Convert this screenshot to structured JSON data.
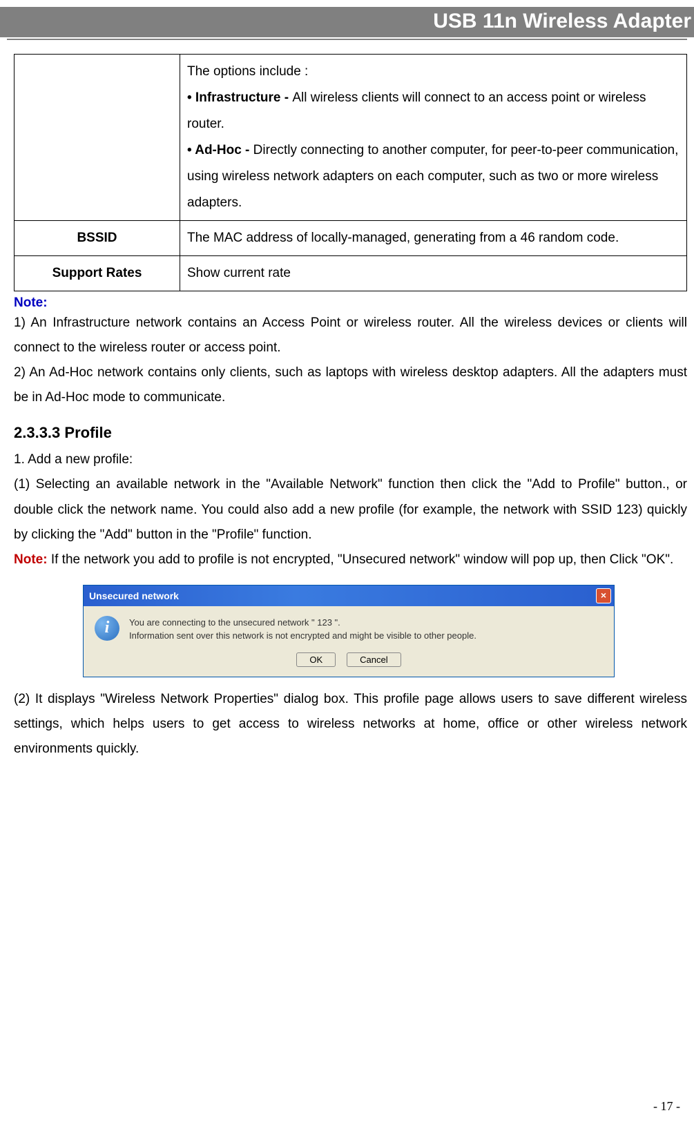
{
  "header": {
    "title": "USB 11n Wireless Adapter"
  },
  "table": {
    "row1": {
      "options_intro": "The options include :",
      "bullet1_label": "• Infrastructure - ",
      "bullet1_text": "All wireless clients will connect to an access point or wireless router.",
      "bullet2_label": "• Ad-Hoc - ",
      "bullet2_text": "Directly connecting to another computer, for peer-to-peer communication, using wireless network adapters on each computer, such as two or more wireless adapters."
    },
    "row2": {
      "label": "BSSID",
      "text": "The MAC address of locally-managed, generating from a 46 random code."
    },
    "row3": {
      "label": "Support Rates",
      "text": "Show current rate"
    }
  },
  "note_section": {
    "label": "Note:",
    "line1": "1) An Infrastructure network contains an Access Point or wireless router. All the wireless devices or clients will connect to the wireless router or access point.",
    "line2": "2) An Ad-Hoc network contains only clients, such as laptops with wireless desktop adapters. All the adapters must be in Ad-Hoc mode to communicate."
  },
  "section": {
    "heading": "2.3.3.3    Profile",
    "p1": "1. Add a new profile:",
    "p2": "(1) Selecting an available network in the \"Available Network\" function then click the \"Add to Profile\" button., or double click the network name. You could also add a new profile (for example, the network with SSID 123) quickly by clicking the \"Add\" button in the \"Profile\" function.",
    "note_label": "Note:",
    "note_text": " If the network you add to profile is not encrypted, \"Unsecured network\" window will pop up, then Click \"OK\".",
    "p3": "(2) It displays \"Wireless Network Properties\" dialog box. This profile page allows users to save different wireless settings, which helps users to get access to wireless networks at home, office or other wireless network environments quickly."
  },
  "dialog": {
    "title": "Unsecured network",
    "line1": "You are connecting to the unsecured network \" 123 \".",
    "line2": "Information sent over this network is not encrypted and might be visible to other people.",
    "ok": "OK",
    "cancel": "Cancel"
  },
  "page_number": "- 17 -"
}
